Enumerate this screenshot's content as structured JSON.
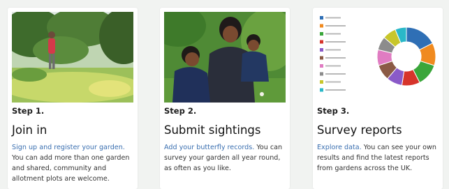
{
  "cards": [
    {
      "step": "Step 1.",
      "title": "Join in",
      "link": "Sign up and register your garden.",
      "text": "You can add more than one garden and shared, community and allotment plots are welcome."
    },
    {
      "step": "Step 2.",
      "title": "Submit sightings",
      "link": "Add your butterfly records.",
      "text": "You can survey your garden all year round, as often as you like."
    },
    {
      "step": "Step 3.",
      "title": "Survey reports",
      "link": "Explore data.",
      "text": "You can see your own results and find the latest reports from gardens across the UK."
    }
  ],
  "colors": {
    "link": "#3a6fb0",
    "donut": [
      "#2f6fb5",
      "#f08a1f",
      "#3aa63a",
      "#d6342b",
      "#8a5ac8",
      "#8b5a45",
      "#e07cc2",
      "#8c8c8c",
      "#c8c62a",
      "#2ab8c8"
    ]
  },
  "chart_data": {
    "type": "pie",
    "title": "",
    "series": [
      {
        "value": 14
      },
      {
        "value": 10
      },
      {
        "value": 10
      },
      {
        "value": 8
      },
      {
        "value": 7
      },
      {
        "value": 7
      },
      {
        "value": 7
      },
      {
        "value": 6
      },
      {
        "value": 6
      },
      {
        "value": 5
      }
    ]
  }
}
